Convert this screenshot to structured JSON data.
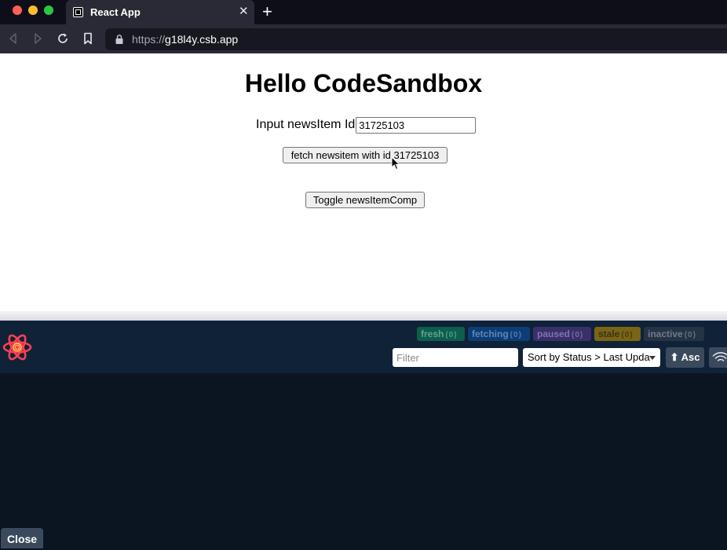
{
  "browser": {
    "tab_title": "React App",
    "tab_close": "✕",
    "new_tab": "+",
    "url_scheme": "https://",
    "url_host": "g18l4y.csb.app"
  },
  "page": {
    "title": "Hello CodeSandbox",
    "input_label": "Input newsItem Id",
    "input_value": "31725103",
    "fetch_button": "fetch newsitem with id 31725103",
    "toggle_button": "Toggle newsItemComp"
  },
  "devtools": {
    "badges": [
      {
        "label": "fresh",
        "count": "(0)"
      },
      {
        "label": "fetching",
        "count": "(0)"
      },
      {
        "label": "paused",
        "count": "(0)"
      },
      {
        "label": "stale",
        "count": "(0)"
      },
      {
        "label": "inactive",
        "count": "(0)"
      }
    ],
    "filter_placeholder": "Filter",
    "sort_selected": "Sort by Status > Last Upda",
    "asc_label": "⬆ Asc",
    "close_label": "Close"
  },
  "colors": {
    "badge_fresh": "#0b5f4c",
    "badge_fetching": "#0d3d77",
    "badge_paused": "#3a2f6b",
    "badge_stale": "#7a6514",
    "badge_inactive": "#243446"
  }
}
